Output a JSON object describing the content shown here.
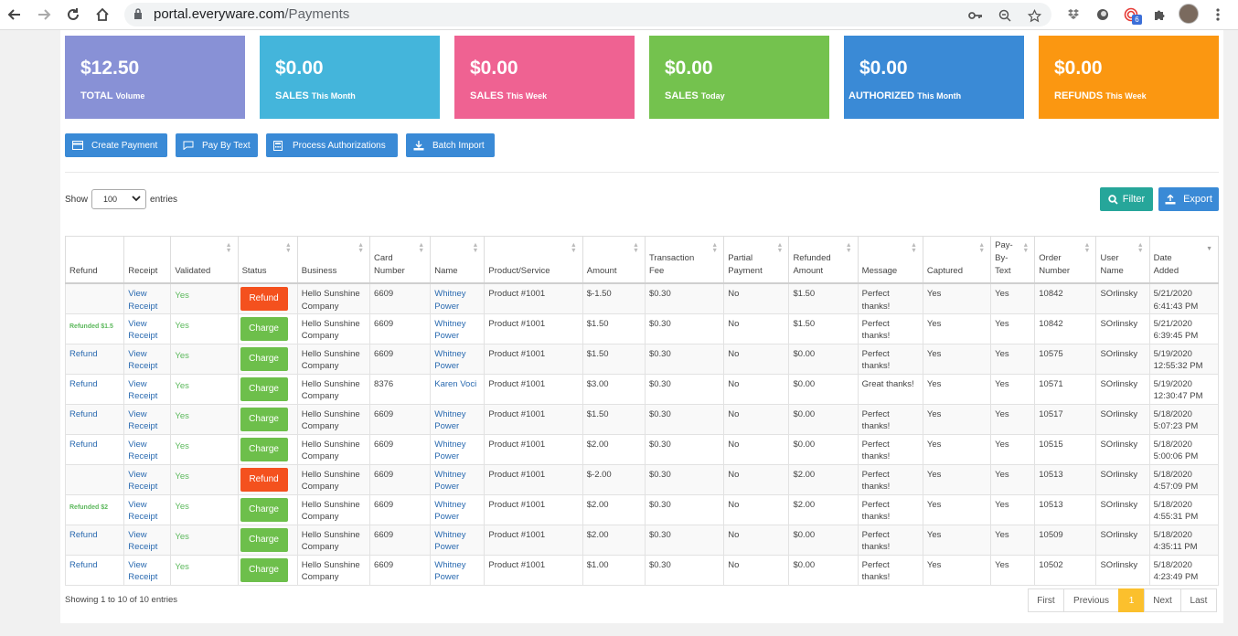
{
  "browser": {
    "url_host": "portal.everyware.com",
    "url_path": "/Payments",
    "extension_badge": "6"
  },
  "stats": [
    {
      "amount": "$12.50",
      "label": "TOTAL",
      "sub": "Volume",
      "color": "#8891d6"
    },
    {
      "amount": "$0.00",
      "label": "SALES",
      "sub": "This Month",
      "color": "#44b5db"
    },
    {
      "amount": "$0.00",
      "label": "SALES",
      "sub": "This Week",
      "color": "#ef6292"
    },
    {
      "amount": "$0.00",
      "label": "SALES",
      "sub": "Today",
      "color": "#74c24e"
    },
    {
      "amount": "$0.00",
      "label": "AUTHORIZED",
      "sub": "This Month",
      "color": "#3a8ad6"
    },
    {
      "amount": "$0.00",
      "label": "REFUNDS",
      "sub": "This Week",
      "color": "#fb9711"
    }
  ],
  "actions": {
    "create_payment": "Create Payment",
    "pay_by_text": "Pay By Text",
    "process_authorizations": "Process Authorizations",
    "batch_import": "Batch Import"
  },
  "entries": {
    "show": "Show",
    "value": "100",
    "suffix": "entries"
  },
  "toolbar": {
    "filter": "Filter",
    "export": "Export"
  },
  "table": {
    "headers": {
      "refund": "Refund",
      "receipt": "Receipt",
      "validated": "Validated",
      "status": "Status",
      "business": "Business",
      "card_number": "Card Number",
      "name": "Name",
      "product": "Product/Service",
      "amount": "Amount",
      "transaction_fee": "Transaction Fee",
      "partial_payment": "Partial Payment",
      "refunded_amount": "Refunded Amount",
      "message": "Message",
      "captured": "Captured",
      "pay_by_text": "Pay- By- Text",
      "order_number": "Order Number",
      "user_name": "User Name",
      "date_added": "Date Added"
    },
    "rows": [
      {
        "refund": "",
        "refunded": "",
        "receipt": "View Receipt",
        "validated": "Yes",
        "status": "Refund",
        "business": "Hello Sunshine Company",
        "card": "6609",
        "name": "Whitney Power",
        "product": "Product #1001",
        "amount": "$-1.50",
        "fee": "$0.30",
        "partial": "No",
        "refunded_amount": "$1.50",
        "message": "Perfect thanks!",
        "captured": "Yes",
        "pbt": "Yes",
        "order": "10842",
        "user": "SOrlinsky",
        "date": "5/21/2020 6:41:43 PM"
      },
      {
        "refund": "",
        "refunded": "Refunded $1.5",
        "receipt": "View Receipt",
        "validated": "Yes",
        "status": "Charge",
        "business": "Hello Sunshine Company",
        "card": "6609",
        "name": "Whitney Power",
        "product": "Product #1001",
        "amount": "$1.50",
        "fee": "$0.30",
        "partial": "No",
        "refunded_amount": "$1.50",
        "message": "Perfect thanks!",
        "captured": "Yes",
        "pbt": "Yes",
        "order": "10842",
        "user": "SOrlinsky",
        "date": "5/21/2020 6:39:45 PM"
      },
      {
        "refund": "Refund",
        "refunded": "",
        "receipt": "View Receipt",
        "validated": "Yes",
        "status": "Charge",
        "business": "Hello Sunshine Company",
        "card": "6609",
        "name": "Whitney Power",
        "product": "Product #1001",
        "amount": "$1.50",
        "fee": "$0.30",
        "partial": "No",
        "refunded_amount": "$0.00",
        "message": "Perfect thanks!",
        "captured": "Yes",
        "pbt": "Yes",
        "order": "10575",
        "user": "SOrlinsky",
        "date": "5/19/2020 12:55:32 PM"
      },
      {
        "refund": "Refund",
        "refunded": "",
        "receipt": "View Receipt",
        "validated": "Yes",
        "status": "Charge",
        "business": "Hello Sunshine Company",
        "card": "8376",
        "name": "Karen Voci",
        "product": "Product #1001",
        "amount": "$3.00",
        "fee": "$0.30",
        "partial": "No",
        "refunded_amount": "$0.00",
        "message": "Great thanks!",
        "captured": "Yes",
        "pbt": "Yes",
        "order": "10571",
        "user": "SOrlinsky",
        "date": "5/19/2020 12:30:47 PM"
      },
      {
        "refund": "Refund",
        "refunded": "",
        "receipt": "View Receipt",
        "validated": "Yes",
        "status": "Charge",
        "business": "Hello Sunshine Company",
        "card": "6609",
        "name": "Whitney Power",
        "product": "Product #1001",
        "amount": "$1.50",
        "fee": "$0.30",
        "partial": "No",
        "refunded_amount": "$0.00",
        "message": "Perfect thanks!",
        "captured": "Yes",
        "pbt": "Yes",
        "order": "10517",
        "user": "SOrlinsky",
        "date": "5/18/2020 5:07:23 PM"
      },
      {
        "refund": "Refund",
        "refunded": "",
        "receipt": "View Receipt",
        "validated": "Yes",
        "status": "Charge",
        "business": "Hello Sunshine Company",
        "card": "6609",
        "name": "Whitney Power",
        "product": "Product #1001",
        "amount": "$2.00",
        "fee": "$0.30",
        "partial": "No",
        "refunded_amount": "$0.00",
        "message": "Perfect thanks!",
        "captured": "Yes",
        "pbt": "Yes",
        "order": "10515",
        "user": "SOrlinsky",
        "date": "5/18/2020 5:00:06 PM"
      },
      {
        "refund": "",
        "refunded": "",
        "receipt": "View Receipt",
        "validated": "Yes",
        "status": "Refund",
        "business": "Hello Sunshine Company",
        "card": "6609",
        "name": "Whitney Power",
        "product": "Product #1001",
        "amount": "$-2.00",
        "fee": "$0.30",
        "partial": "No",
        "refunded_amount": "$2.00",
        "message": "Perfect thanks!",
        "captured": "Yes",
        "pbt": "Yes",
        "order": "10513",
        "user": "SOrlinsky",
        "date": "5/18/2020 4:57:09 PM"
      },
      {
        "refund": "",
        "refunded": "Refunded $2",
        "receipt": "View Receipt",
        "validated": "Yes",
        "status": "Charge",
        "business": "Hello Sunshine Company",
        "card": "6609",
        "name": "Whitney Power",
        "product": "Product #1001",
        "amount": "$2.00",
        "fee": "$0.30",
        "partial": "No",
        "refunded_amount": "$2.00",
        "message": "Perfect thanks!",
        "captured": "Yes",
        "pbt": "Yes",
        "order": "10513",
        "user": "SOrlinsky",
        "date": "5/18/2020 4:55:31 PM"
      },
      {
        "refund": "Refund",
        "refunded": "",
        "receipt": "View Receipt",
        "validated": "Yes",
        "status": "Charge",
        "business": "Hello Sunshine Company",
        "card": "6609",
        "name": "Whitney Power",
        "product": "Product #1001",
        "amount": "$2.00",
        "fee": "$0.30",
        "partial": "No",
        "refunded_amount": "$0.00",
        "message": "Perfect thanks!",
        "captured": "Yes",
        "pbt": "Yes",
        "order": "10509",
        "user": "SOrlinsky",
        "date": "5/18/2020 4:35:11 PM"
      },
      {
        "refund": "Refund",
        "refunded": "",
        "receipt": "View Receipt",
        "validated": "Yes",
        "status": "Charge",
        "business": "Hello Sunshine Company",
        "card": "6609",
        "name": "Whitney Power",
        "product": "Product #1001",
        "amount": "$1.00",
        "fee": "$0.30",
        "partial": "No",
        "refunded_amount": "$0.00",
        "message": "Perfect thanks!",
        "captured": "Yes",
        "pbt": "Yes",
        "order": "10502",
        "user": "SOrlinsky",
        "date": "5/18/2020 4:23:49 PM"
      }
    ]
  },
  "footer": {
    "showing": "Showing 1 to 10 of 10 entries",
    "pagination": {
      "first": "First",
      "previous": "Previous",
      "current": "1",
      "next": "Next",
      "last": "Last"
    }
  }
}
